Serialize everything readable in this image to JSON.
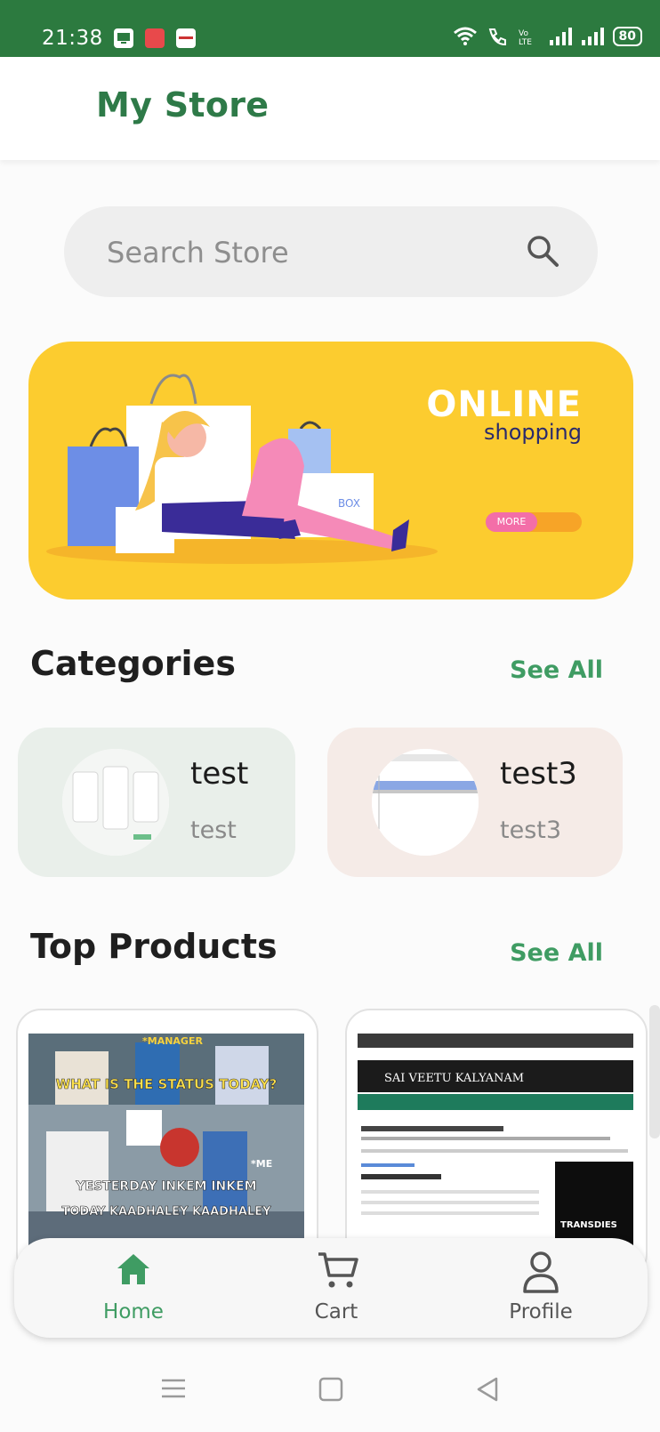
{
  "status_bar": {
    "time": "21:38",
    "battery": "80"
  },
  "header": {
    "title": "My Store"
  },
  "search": {
    "placeholder": "Search Store",
    "value": ""
  },
  "banner": {
    "headline": "ONLINE",
    "subheadline": "shopping",
    "more_label": "MORE",
    "box_label": "BOX"
  },
  "categories": {
    "title": "Categories",
    "see_all": "See All",
    "items": [
      {
        "name": "test",
        "description": "test"
      },
      {
        "name": "test3",
        "description": "test3"
      }
    ]
  },
  "top_products": {
    "title": "Top Products",
    "see_all": "See All",
    "items": [
      {
        "image_caption_top": "WHAT IS THE STATUS TODAY?",
        "image_tag": "*MANAGER",
        "image_caption_bottom_1": "YESTERDAY INKEM INKEM",
        "image_caption_bottom_2": "TODAY KAADHALEY KAADHALEY",
        "image_tag_2": "*ME"
      },
      {
        "image_caption_top": "SAI VEETU KALYANAM",
        "image_tag": "TRANSDIES"
      }
    ]
  },
  "bottom_nav": {
    "items": [
      {
        "label": "Home",
        "icon": "home-icon",
        "active": true
      },
      {
        "label": "Cart",
        "icon": "cart-icon",
        "active": false
      },
      {
        "label": "Profile",
        "icon": "profile-icon",
        "active": false
      }
    ]
  },
  "colors": {
    "status_bar": "#2c7a3f",
    "brand_green": "#2e7a48",
    "accent_green": "#3f9c63",
    "banner_yellow": "#fccc2f",
    "category_card_1": "#e9efea",
    "category_card_2": "#f5ebe7"
  }
}
